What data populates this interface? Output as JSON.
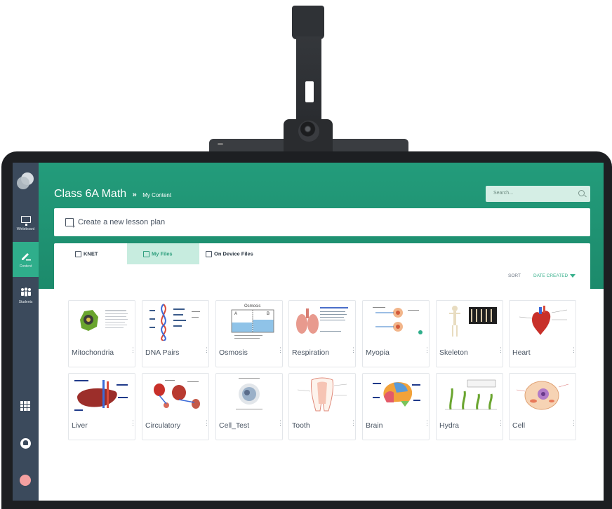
{
  "sidebar": {
    "items": [
      {
        "label": "Whiteboard",
        "icon": "whiteboard-icon"
      },
      {
        "label": "Content",
        "icon": "pencil-icon"
      },
      {
        "label": "Students",
        "icon": "students-icon"
      }
    ],
    "active": "Content"
  },
  "header": {
    "title": "Class 6A Math",
    "separator": "»",
    "breadcrumb": "My Content"
  },
  "search": {
    "placeholder": "Search..."
  },
  "create_lesson": {
    "label": "Create a new lesson plan"
  },
  "tabs": [
    {
      "label": "KNET",
      "active": false
    },
    {
      "label": "My Files",
      "active": true
    },
    {
      "label": "On Device Files",
      "active": false
    }
  ],
  "sort": {
    "label": "SORT",
    "value": "DATE CREATED"
  },
  "files": [
    {
      "name": "Mitochondria"
    },
    {
      "name": "DNA Pairs"
    },
    {
      "name": "Osmosis"
    },
    {
      "name": "Respiration"
    },
    {
      "name": "Myopia"
    },
    {
      "name": "Skeleton"
    },
    {
      "name": "Heart"
    },
    {
      "name": "Liver"
    },
    {
      "name": "Circulatory"
    },
    {
      "name": "Cell_Test"
    },
    {
      "name": "Tooth"
    },
    {
      "name": "Brain"
    },
    {
      "name": "Hydra"
    },
    {
      "name": "Cell"
    }
  ],
  "thumbnails": {
    "osmosis_title": "Osmosis",
    "osmosis_a": "A",
    "osmosis_b": "B"
  },
  "colors": {
    "accent": "#239c7b",
    "sidebar": "#3b4a5c",
    "active_tab": "#c7ecdf"
  }
}
